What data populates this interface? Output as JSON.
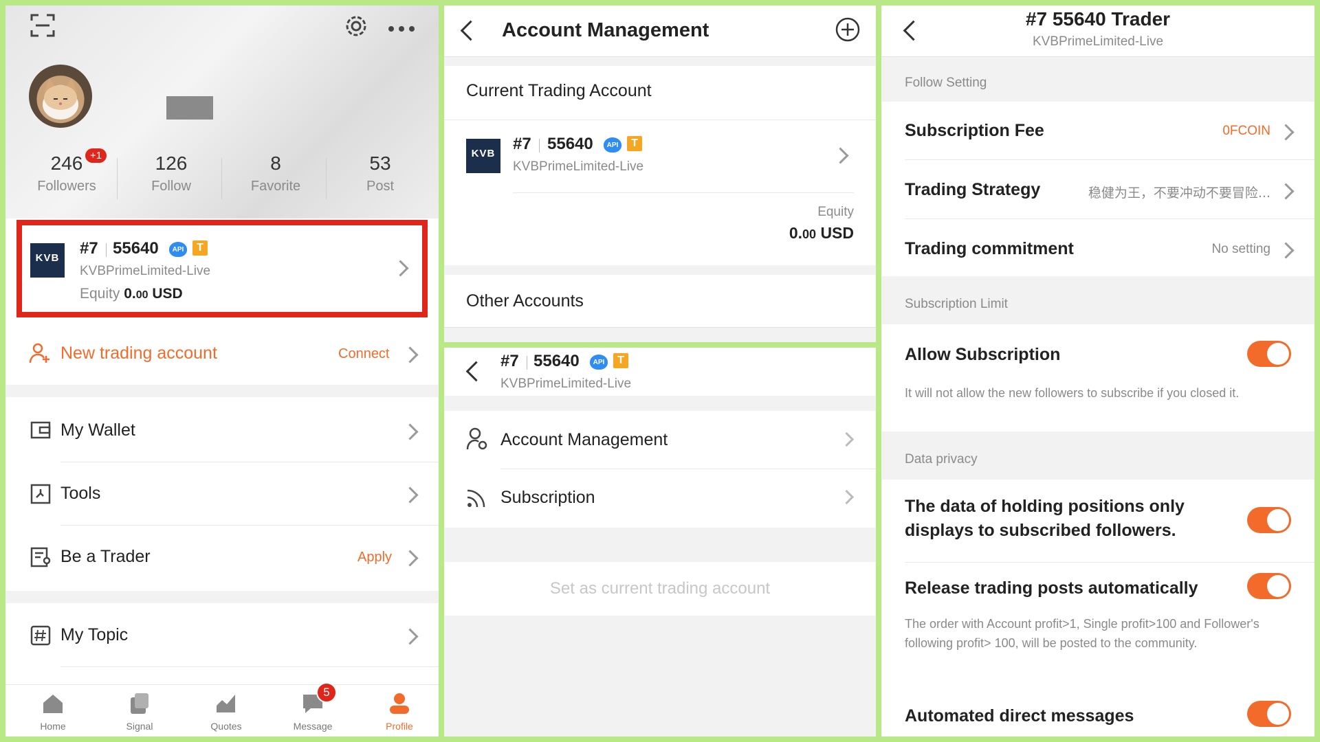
{
  "profile": {
    "stats": [
      {
        "count": "246",
        "label": "Followers"
      },
      {
        "count": "126",
        "label": "Follow"
      },
      {
        "count": "8",
        "label": "Favorite"
      },
      {
        "count": "53",
        "label": "Post"
      }
    ],
    "followers_badge": "+1",
    "account_card": {
      "rank": "#7",
      "id": "55640",
      "api_badge": "API",
      "t_badge": "T",
      "broker": "KVBPrimeLimited-Live",
      "equity_label": "Equity",
      "equity_int": "0.",
      "equity_dec": "00",
      "equity_unit": "USD",
      "logo_text": "KVB"
    },
    "new_account": {
      "label": "New trading account",
      "action": "Connect"
    },
    "menu": [
      {
        "label": "My Wallet",
        "action": ""
      },
      {
        "label": "Tools",
        "action": ""
      },
      {
        "label": "Be a Trader",
        "action": "Apply"
      },
      {
        "label": "My Topic",
        "action": ""
      }
    ],
    "tabbar": [
      {
        "label": "Home"
      },
      {
        "label": "Signal"
      },
      {
        "label": "Quotes"
      },
      {
        "label": "Message",
        "badge": "5"
      },
      {
        "label": "Profile"
      }
    ]
  },
  "account_mgmt": {
    "title": "Account Management",
    "current_header": "Current Trading Account",
    "rank": "#7",
    "id": "55640",
    "broker": "KVBPrimeLimited-Live",
    "equity_label": "Equity",
    "equity_int": "0.",
    "equity_dec": "00",
    "equity_unit": "USD",
    "other_header": "Other Accounts"
  },
  "account_detail": {
    "rank": "#7",
    "id": "55640",
    "broker": "KVBPrimeLimited-Live",
    "items": [
      {
        "label": "Account Management"
      },
      {
        "label": "Subscription"
      }
    ],
    "set_current": "Set as current trading account"
  },
  "trader_settings": {
    "title": "#7 55640 Trader",
    "subtitle": "KVBPrimeLimited-Live",
    "follow_setting_header": "Follow Setting",
    "subscription_fee": {
      "label": "Subscription Fee",
      "value": "0FCOIN"
    },
    "trading_strategy": {
      "label": "Trading Strategy",
      "value": "稳健为王，不要冲动不要冒险..."
    },
    "trading_commitment": {
      "label": "Trading commitment",
      "value": "No setting"
    },
    "subscription_limit_header": "Subscription Limit",
    "allow_subscription": {
      "label": "Allow Subscription",
      "desc": "It will not allow the new followers to subscribe if you closed it.",
      "on": true
    },
    "data_privacy_header": "Data privacy",
    "holding_positions": {
      "label": "The data of holding positions only displays to subscribed followers.",
      "on": true
    },
    "release_posts": {
      "label": "Release trading posts automatically",
      "desc": "The order with Account profit>1, Single profit>100 and Follower's following profit> 100, will be posted to the community.",
      "on": true
    },
    "auto_dm": {
      "label": "Automated direct messages",
      "on": true
    }
  },
  "colors": {
    "accent": "#f26b2a",
    "highlight_border": "#e0261b",
    "panel_bg": "#b8e986",
    "api_blue": "#2f8cf0",
    "t_orange": "#f5a623"
  }
}
